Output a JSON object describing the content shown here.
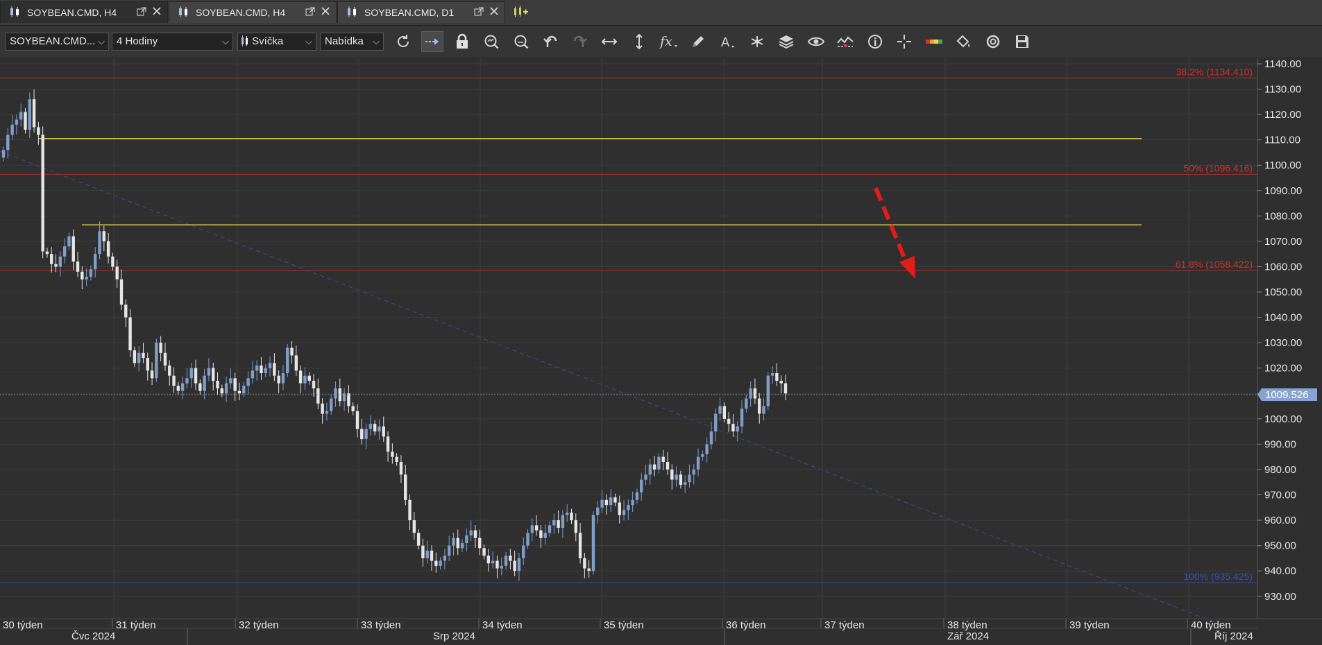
{
  "tabs": [
    {
      "title": "SOYBEAN.CMD, H4",
      "active": true
    },
    {
      "title": "SOYBEAN.CMD, H4",
      "active": false
    },
    {
      "title": "SOYBEAN.CMD, D1",
      "active": false
    }
  ],
  "toolbar": {
    "instrument": "SOYBEAN.CMD...",
    "timeframe": "4 Hodiny",
    "chart_type": "Svíčka",
    "price_side": "Nabídka",
    "tools": [
      "refresh-icon",
      "autoscroll-icon",
      "lock-icon",
      "zoom-in-icon",
      "zoom-out-icon",
      "undo-icon",
      "redo-icon",
      "horizontal-fit-icon",
      "vertical-fit-icon",
      "indicators-icon",
      "pencil-icon",
      "text-icon",
      "pattern-icon",
      "layers-icon",
      "eye-icon",
      "signals-icon",
      "info-icon",
      "crosshair-icon",
      "heatmap-icon",
      "paint-bucket-icon",
      "reset-icon",
      "save-icon"
    ]
  },
  "colors": {
    "background": "#2f2f2f",
    "grid": "#3c3c3c",
    "candle_up": "#7f9fc9",
    "candle_down": "#e6e6e6",
    "fib_red": "#d92c2c",
    "fib_blue": "#3e4fb0",
    "support_line": "#e8d94a",
    "arrow": "#e21b1b",
    "price_tag": "#86a4cf"
  },
  "chart_data": {
    "type": "candlestick",
    "symbol": "SOYBEAN.CMD",
    "timeframe": "H4",
    "ylim": [
      925,
      1144
    ],
    "y_ticks": [
      "930.00",
      "940.00",
      "950.00",
      "960.00",
      "970.00",
      "980.00",
      "990.00",
      "1000.00",
      "1010.00",
      "1020.00",
      "1030.00",
      "1040.00",
      "1050.00",
      "1060.00",
      "1070.00",
      "1080.00",
      "1090.00",
      "1100.00",
      "1110.00",
      "1120.00",
      "1130.00",
      "1140.00"
    ],
    "current_price": "1009.526",
    "current_value": 1009.526,
    "week_labels": [
      "30 týden",
      "31 týden",
      "32 týden",
      "33 týden",
      "34 týden",
      "35 týden",
      "36 týden",
      "37 týden",
      "38 týden",
      "39 týden",
      "40 týden"
    ],
    "month_labels": [
      "Čvc 2024",
      "Srp 2024",
      "Zář 2024",
      "Říj 2024"
    ],
    "fib_levels": [
      {
        "label": "38.2% (1134.410)",
        "value": 1134.41,
        "color": "red"
      },
      {
        "label": "50% (1096.416)",
        "value": 1096.416,
        "color": "red"
      },
      {
        "label": "61.8% (1058.422)",
        "value": 1058.422,
        "color": "red"
      },
      {
        "label": "100% (935.425)",
        "value": 935.425,
        "color": "blue"
      }
    ],
    "support_lines": [
      1110.5,
      1076.5
    ],
    "closes": [
      1106,
      1112,
      1116,
      1118,
      1121,
      1114,
      1126,
      1115,
      1112,
      1066,
      1065,
      1061,
      1060,
      1064,
      1068,
      1072,
      1062,
      1058,
      1055,
      1056,
      1059,
      1065,
      1074,
      1070,
      1064,
      1060,
      1055,
      1045,
      1040,
      1027,
      1022,
      1026,
      1024,
      1019,
      1016,
      1030,
      1026,
      1021,
      1017,
      1013,
      1011,
      1014,
      1016,
      1020,
      1014,
      1011,
      1017,
      1020,
      1015,
      1012,
      1010,
      1014,
      1016,
      1011,
      1010,
      1013,
      1016,
      1019,
      1021,
      1018,
      1020,
      1022,
      1017,
      1014,
      1018,
      1028,
      1025,
      1019,
      1014,
      1017,
      1015,
      1012,
      1006,
      1002,
      1003,
      1008,
      1012,
      1007,
      1010,
      1005,
      1003,
      996,
      992,
      996,
      998,
      995,
      997,
      993,
      987,
      985,
      983,
      978,
      968,
      960,
      955,
      950,
      945,
      948,
      944,
      942,
      944,
      946,
      950,
      953,
      949,
      951,
      954,
      956,
      953,
      949,
      946,
      943,
      944,
      941,
      942,
      946,
      944,
      940,
      945,
      950,
      955,
      958,
      956,
      953,
      955,
      958,
      960,
      957,
      962,
      963,
      960,
      955,
      945,
      941,
      940,
      962,
      965,
      968,
      966,
      969,
      967,
      962,
      964,
      966,
      968,
      971,
      976,
      978,
      982,
      980,
      985,
      983,
      980,
      976,
      978,
      974,
      975,
      978,
      980,
      985,
      986,
      990,
      995,
      1002,
      1005,
      1000,
      998,
      995,
      997,
      1004,
      1008,
      1012,
      1008,
      1002,
      1005,
      1017,
      1018,
      1015,
      1014,
      1010
    ],
    "x_domain": [
      0,
      280
    ]
  }
}
